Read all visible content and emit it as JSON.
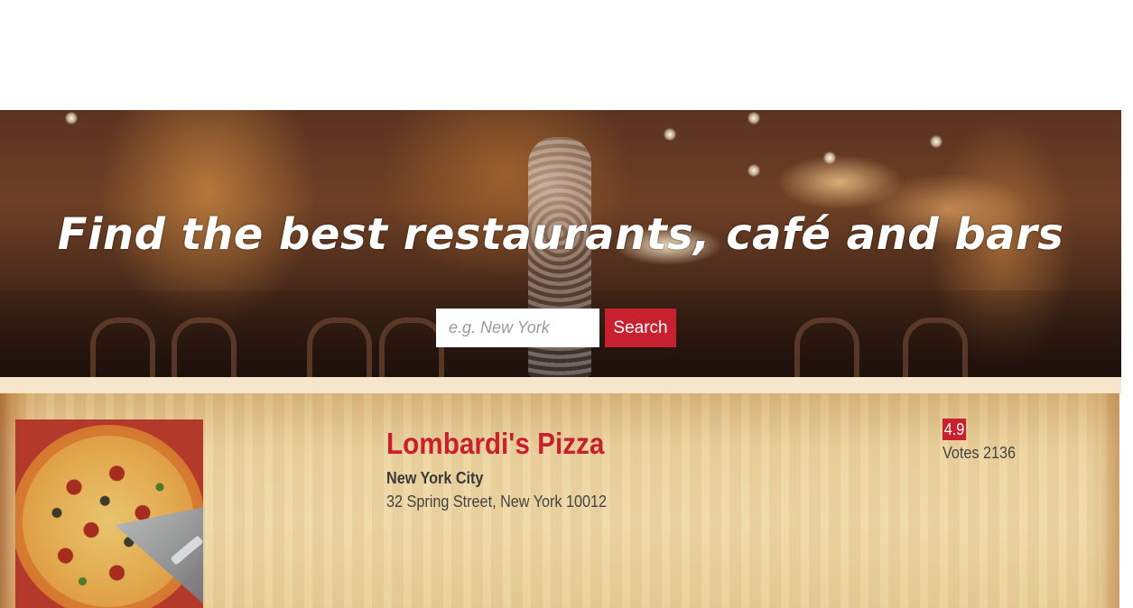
{
  "hero": {
    "title": "Find the best restaurants, café and bars",
    "search": {
      "placeholder": "e.g. New York",
      "value": "",
      "button_label": "Search"
    }
  },
  "results": [
    {
      "name": "Lombardi's Pizza",
      "city": "New York City",
      "address": "32 Spring Street, New York 10012",
      "rating": "4.9",
      "votes_text": "Votes 2136",
      "thumbnail_icon": "pizza-image"
    }
  ],
  "colors": {
    "accent": "#c8202e",
    "page_background": "#ffffff",
    "divider": "#f7e6cc"
  }
}
